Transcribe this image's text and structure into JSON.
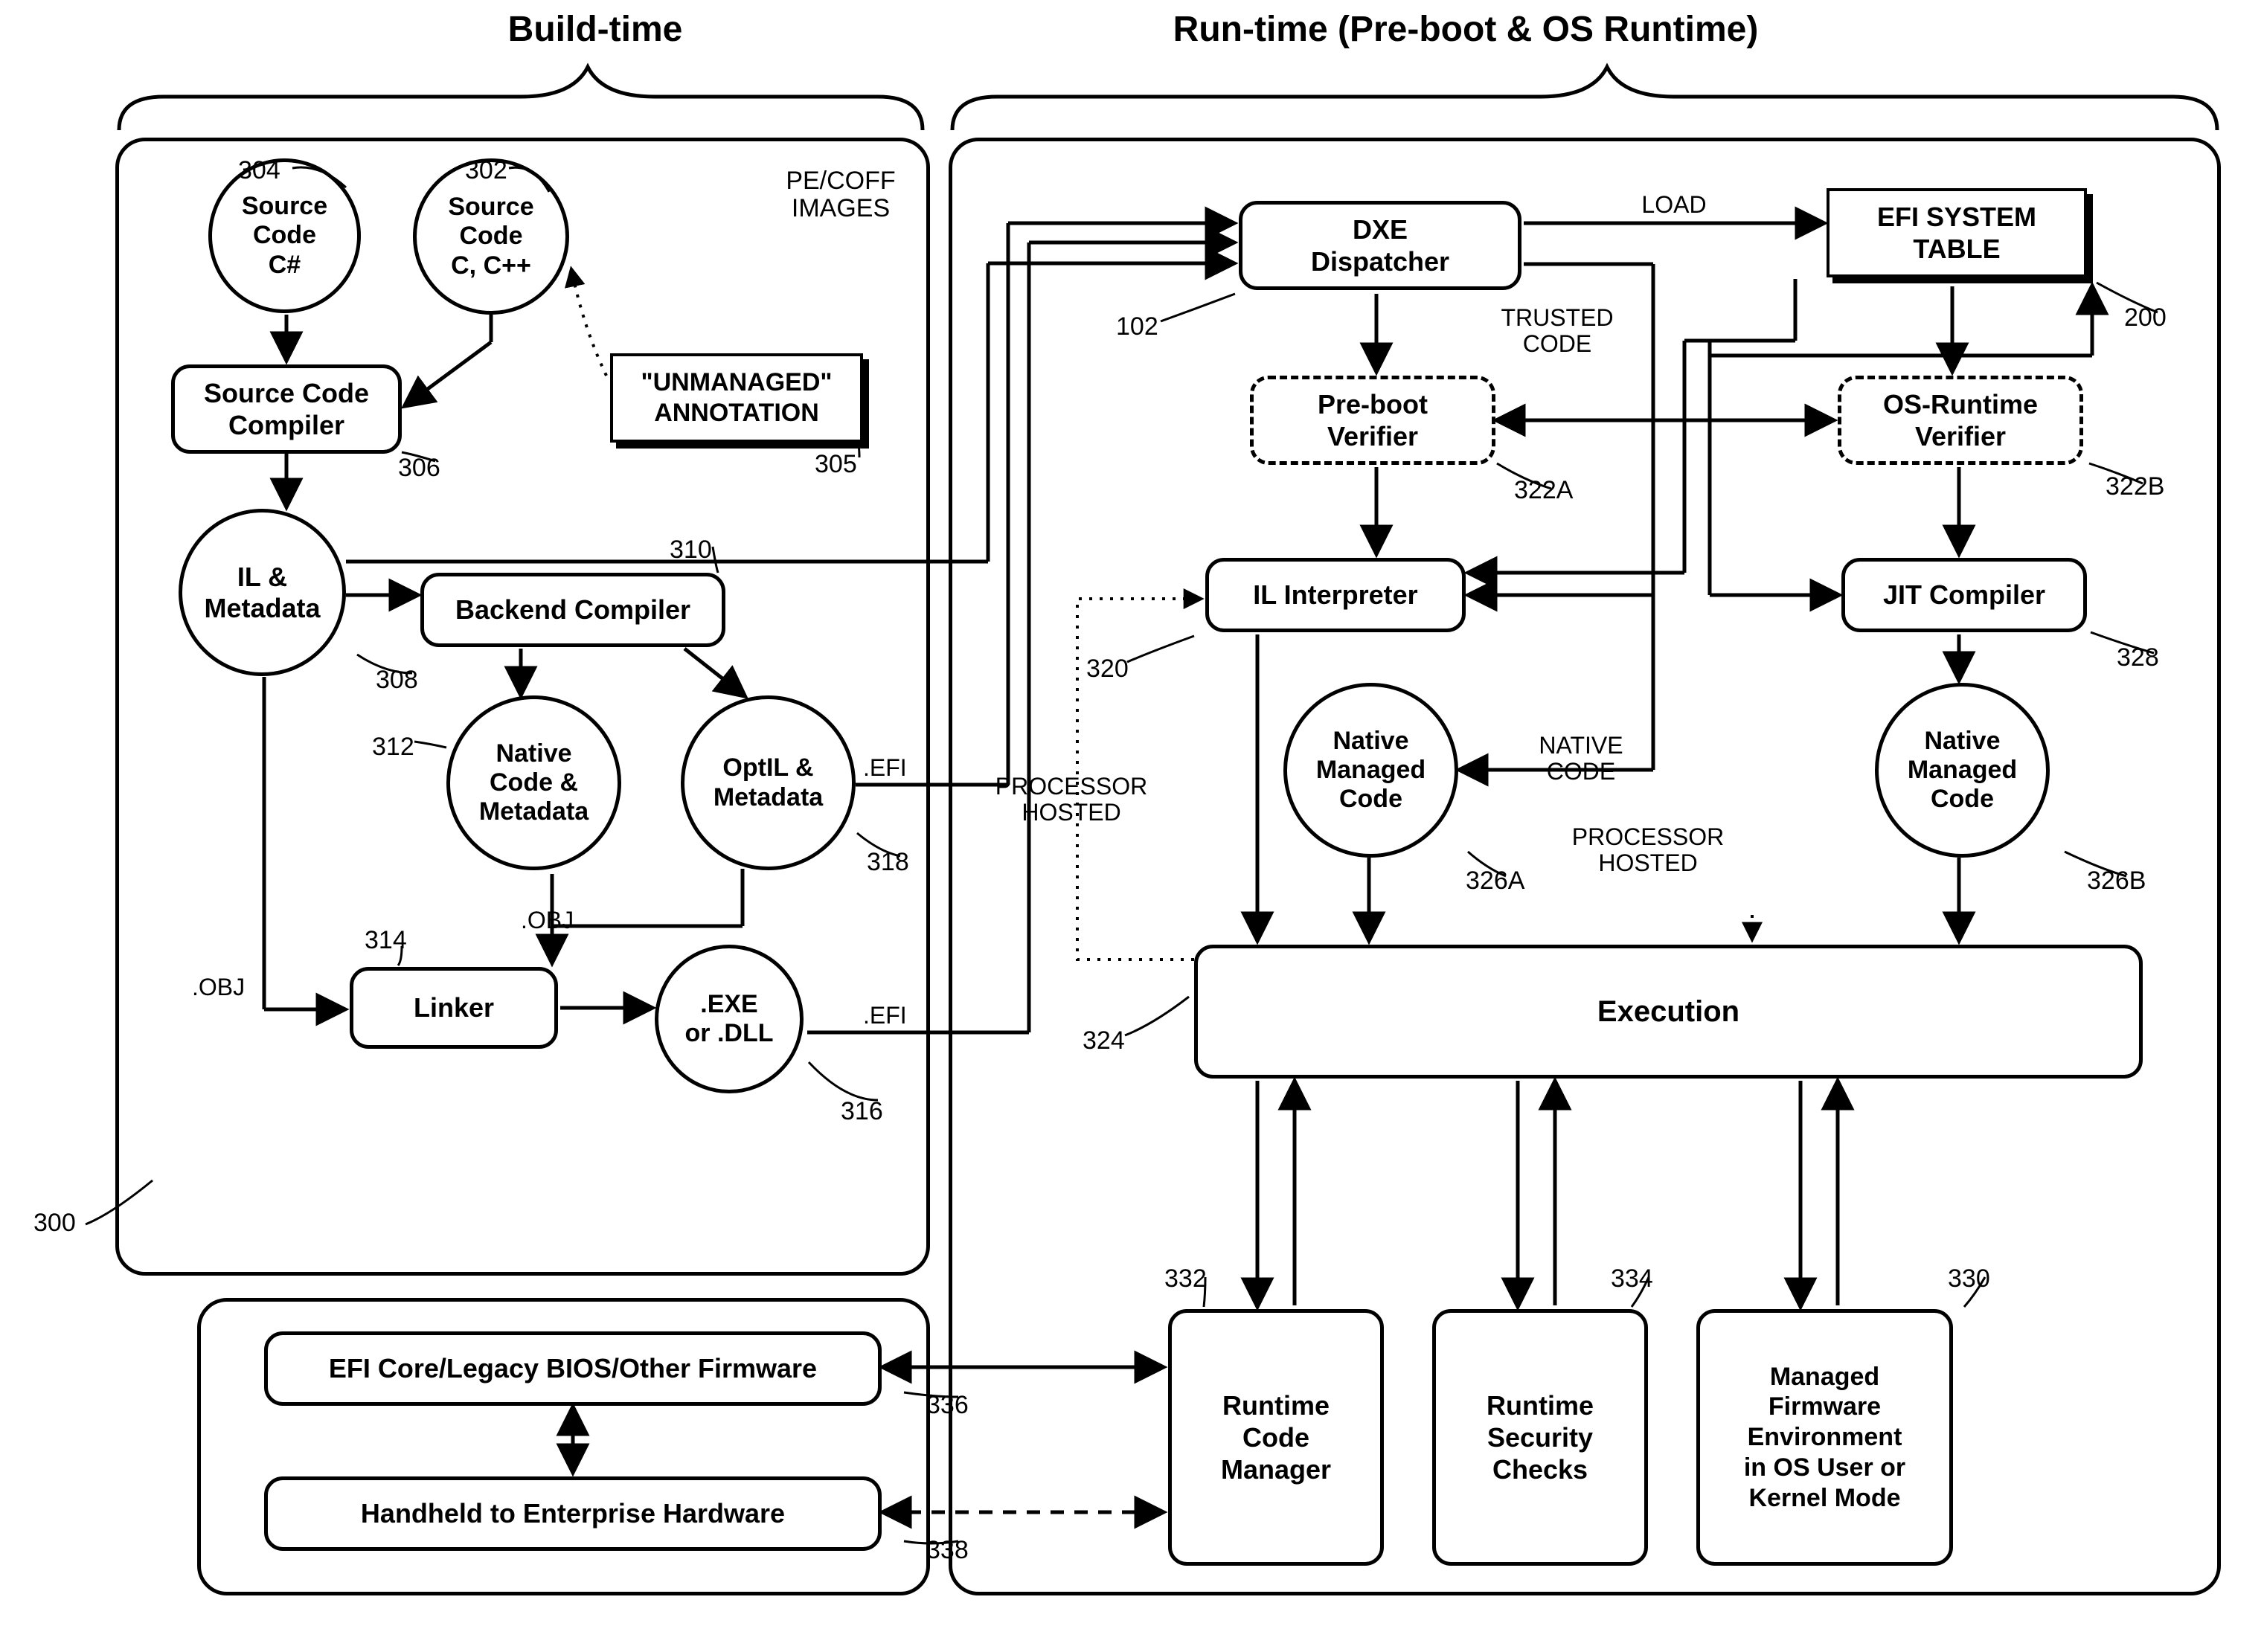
{
  "titles": {
    "build_time": "Build-time",
    "run_time": "Run-time (Pre-boot & OS Runtime)"
  },
  "build": {
    "src_cs": "Source\nCode\nC#",
    "src_c": "Source\nCode\nC, C++",
    "unmanaged": "\"UNMANAGED\"\nANNOTATION",
    "compiler": "Source Code\nCompiler",
    "il_meta": "IL &\nMetadata",
    "backend": "Backend Compiler",
    "native_meta": "Native\nCode &\nMetadata",
    "optil": "OptIL &\nMetadata",
    "linker": "Linker",
    "exedll": ".EXE\nor .DLL",
    "firmware": "EFI Core/Legacy BIOS/Other Firmware",
    "hardware": "Handheld to Enterprise Hardware"
  },
  "run": {
    "pecoff": "PE/COFF\nIMAGES",
    "dxe": "DXE\nDispatcher",
    "load": "LOAD",
    "efitable": "EFI SYSTEM\nTABLE",
    "trusted": "TRUSTED\nCODE",
    "preboot_verifier": "Pre-boot\nVerifier",
    "os_verifier": "OS-Runtime\nVerifier",
    "il_interp": "IL Interpreter",
    "jit": "JIT Compiler",
    "native_managed": "Native\nManaged\nCode",
    "native_code": "NATIVE\nCODE",
    "proc_hosted": "PROCESSOR\nHOSTED",
    "execution": "Execution",
    "rt_code_mgr": "Runtime\nCode\nManager",
    "rt_sec": "Runtime\nSecurity\nChecks",
    "managed_fw": "Managed\nFirmware\nEnvironment\nin OS User or\nKernel Mode"
  },
  "edges": {
    "obj": ".OBJ",
    "efi": ".EFI"
  },
  "refs": {
    "r300": "300",
    "r302": "302",
    "r304": "304",
    "r305": "305",
    "r306": "306",
    "r308": "308",
    "r310": "310",
    "r312": "312",
    "r314": "314",
    "r316": "316",
    "r318": "318",
    "r102": "102",
    "r200": "200",
    "r320": "320",
    "r322a": "322A",
    "r322b": "322B",
    "r324": "324",
    "r326a": "326A",
    "r326b": "326B",
    "r328": "328",
    "r330": "330",
    "r332": "332",
    "r334": "334",
    "r336": "336",
    "r338": "338"
  }
}
